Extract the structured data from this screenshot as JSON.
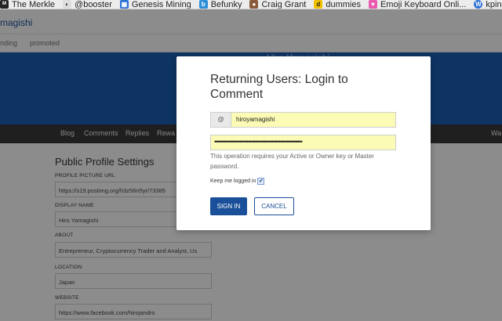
{
  "bookmarks": [
    {
      "label": "The Merkle",
      "icon": "merkle-icon",
      "color": "#222222"
    },
    {
      "label": "@booster",
      "icon": "booster-icon",
      "color": "#333333"
    },
    {
      "label": "Genesis Mining",
      "icon": "genesis-grid-icon",
      "color": "#2a6fd6"
    },
    {
      "label": "Befunky",
      "icon": "befunky-icon",
      "color": "#2b8fd8"
    },
    {
      "label": "Craig Grant",
      "icon": "avatar-icon",
      "color": "#8a5a3a"
    },
    {
      "label": "dummies",
      "icon": "dummies-icon",
      "color": "#f2c200"
    },
    {
      "label": "Emoji Keyboard Onli...",
      "icon": "heart-icon",
      "color": "#e85ab0"
    },
    {
      "label": "kpine",
      "icon": "wordpress-icon",
      "color": "#2a6fd6"
    }
  ],
  "page": {
    "profile_name": "magishi",
    "subnav": [
      "nding",
      "promoted"
    ],
    "banner_name": "Hiro Yamagishi",
    "tabs": [
      "Blog",
      "Comments",
      "Replies",
      "Rewa",
      "Wa"
    ],
    "settings_title": "Public Profile Settings",
    "fields": [
      {
        "label": "PROFILE PICTURE URL",
        "value": "https://s19.postimg.org/h3z56n5yr/73385"
      },
      {
        "label": "DISPLAY NAME",
        "value": "Hiro Yamagishi"
      },
      {
        "label": "ABOUT",
        "value": "Entrepreneur, Cryptocurrency Trader and Analyst, Us"
      },
      {
        "label": "LOCATION",
        "value": "Japan"
      },
      {
        "label": "WEBSITE",
        "value": "https://www.facebook.com/hirojandro"
      }
    ]
  },
  "modal": {
    "title": "Returning Users: Login to Comment",
    "at_symbol": "@",
    "username": "hiroyamagishi",
    "password_mask": "••••••••••••••••••••••••••••••••••••••••••••••••••••",
    "note": "This operation requires your Active or Owner key or Master password.",
    "keep_logged_in": "Keep me logged in",
    "keep_checked": true,
    "check_mark": "✔",
    "signin_label": "SIGN IN",
    "cancel_label": "CANCEL"
  },
  "colors": {
    "accent": "#1a5099",
    "banner": "#1a5fb4",
    "autofill": "#fbfbb5"
  }
}
